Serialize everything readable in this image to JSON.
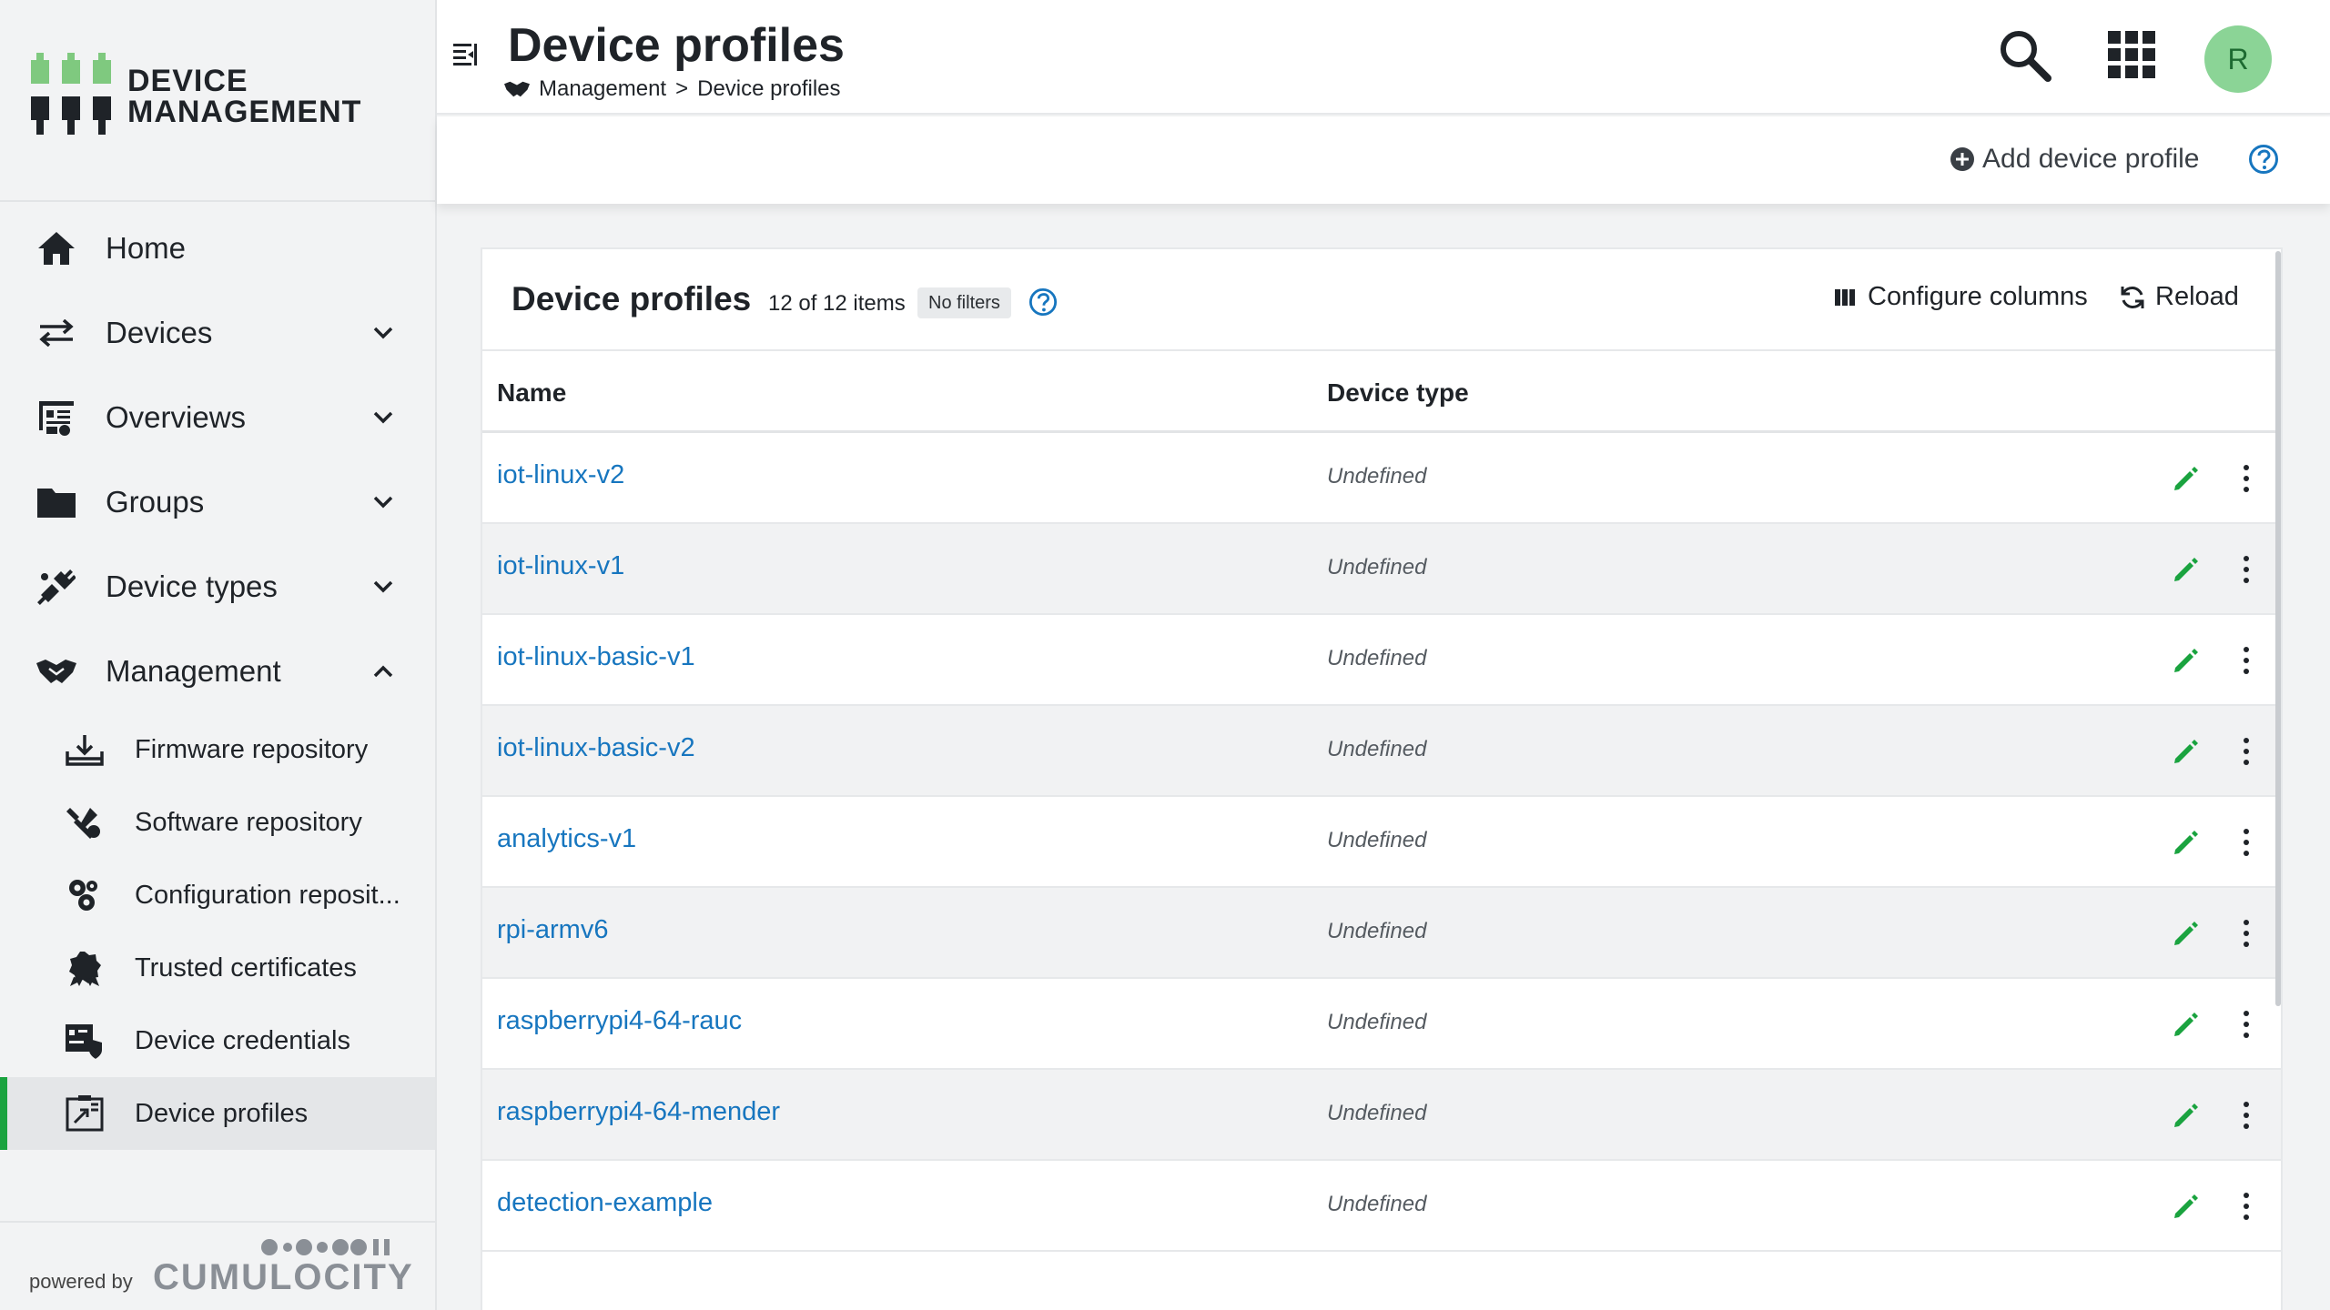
{
  "app": {
    "brand_line1": "DEVICE",
    "brand_line2": "MANAGEMENT",
    "accent_color": "#1aa33f",
    "link_color": "#1776bf"
  },
  "sidebar": {
    "items": [
      {
        "label": "Home",
        "icon": "home-icon",
        "expandable": false
      },
      {
        "label": "Devices",
        "icon": "arrows-exchange-icon",
        "expandable": true
      },
      {
        "label": "Overviews",
        "icon": "dashboard-icon",
        "expandable": true
      },
      {
        "label": "Groups",
        "icon": "folder-icon",
        "expandable": true
      },
      {
        "label": "Device types",
        "icon": "plug-icon",
        "expandable": true
      },
      {
        "label": "Management",
        "icon": "handshake-icon",
        "expandable": true,
        "expanded": true
      }
    ],
    "management_subitems": [
      {
        "label": "Firmware repository",
        "icon": "firmware-icon"
      },
      {
        "label": "Software repository",
        "icon": "software-icon"
      },
      {
        "label": "Configuration reposit...",
        "icon": "gears-icon"
      },
      {
        "label": "Trusted certificates",
        "icon": "certificate-icon"
      },
      {
        "label": "Device credentials",
        "icon": "credentials-icon"
      },
      {
        "label": "Device profiles",
        "icon": "device-profile-icon",
        "active": true
      }
    ],
    "powered_by": "powered by",
    "powered_brand": "CUMULOCITY"
  },
  "header": {
    "title": "Device profiles",
    "breadcrumb_parent": "Management",
    "breadcrumb_separator": ">",
    "breadcrumb_current": "Device profiles",
    "avatar_initial": "R"
  },
  "actionbar": {
    "add_label": "Add device profile"
  },
  "card": {
    "title": "Device profiles",
    "count": "12 of 12 items",
    "filter_badge": "No filters",
    "configure_columns": "Configure columns",
    "reload": "Reload",
    "columns": [
      "Name",
      "Device type"
    ],
    "rows": [
      {
        "name": "iot-linux-v2",
        "type": "Undefined"
      },
      {
        "name": "iot-linux-v1",
        "type": "Undefined"
      },
      {
        "name": "iot-linux-basic-v1",
        "type": "Undefined"
      },
      {
        "name": "iot-linux-basic-v2",
        "type": "Undefined"
      },
      {
        "name": "analytics-v1",
        "type": "Undefined"
      },
      {
        "name": "rpi-armv6",
        "type": "Undefined"
      },
      {
        "name": "raspberrypi4-64-rauc",
        "type": "Undefined"
      },
      {
        "name": "raspberrypi4-64-mender",
        "type": "Undefined"
      },
      {
        "name": "detection-example",
        "type": "Undefined"
      }
    ]
  }
}
